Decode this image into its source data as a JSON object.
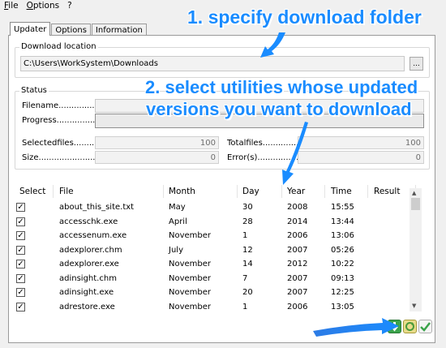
{
  "menu": [
    "File",
    "Options",
    "?"
  ],
  "tabs": [
    "Updater",
    "Options",
    "Information"
  ],
  "download": {
    "group_title": "Download location",
    "path": "C:\\Users\\WorkSystem\\Downloads",
    "browse_label": "..."
  },
  "status": {
    "group_title": "Status",
    "filename_label": "Filename...................",
    "progress_label": "Progress...................",
    "selectedfiles_label": "Selectedfiles...............",
    "selectedfiles_value": "100",
    "size_label": "Size...........................",
    "size_value": "0",
    "totalfiles_label": "Totalfiles.......................",
    "totalfiles_value": "100",
    "errors_label": "Error(s).........................",
    "errors_value": "0"
  },
  "table": {
    "headers": [
      "Select",
      "File",
      "Month",
      "Day",
      "Year",
      "Time",
      "Result"
    ],
    "rows": [
      {
        "file": "about_this_site.txt",
        "month": "May",
        "day": "30",
        "year": "2008",
        "time": "15:55",
        "checked": true
      },
      {
        "file": "accesschk.exe",
        "month": "April",
        "day": "28",
        "year": "2014",
        "time": "13:44",
        "checked": true
      },
      {
        "file": "accessenum.exe",
        "month": "November",
        "day": "1",
        "year": "2006",
        "time": "13:06",
        "checked": true
      },
      {
        "file": "adexplorer.chm",
        "month": "July",
        "day": "12",
        "year": "2007",
        "time": "05:26",
        "checked": true
      },
      {
        "file": "adexplorer.exe",
        "month": "November",
        "day": "14",
        "year": "2012",
        "time": "10:22",
        "checked": true
      },
      {
        "file": "adinsight.chm",
        "month": "November",
        "day": "7",
        "year": "2007",
        "time": "09:13",
        "checked": true
      },
      {
        "file": "adinsight.exe",
        "month": "November",
        "day": "20",
        "year": "2007",
        "time": "12:25",
        "checked": true
      },
      {
        "file": "adrestore.exe",
        "month": "November",
        "day": "1",
        "year": "2006",
        "time": "13:05",
        "checked": true
      }
    ]
  },
  "annotations": {
    "step1": "1. specify download folder",
    "step2_line1": "2. select utilities whose updated",
    "step2_line2": "versions you want to download"
  },
  "colors": {
    "annotation": "#1a8cff",
    "download_button": "#3aa34a",
    "refresh_button": "#c6b33a",
    "ok_button": "#5cb85c"
  }
}
